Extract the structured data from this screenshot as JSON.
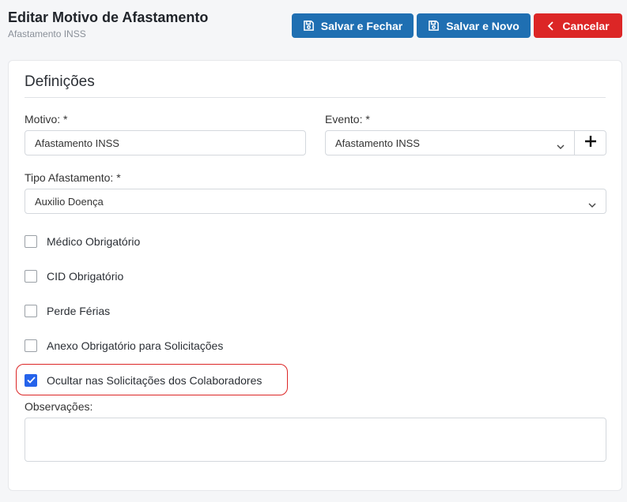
{
  "header": {
    "title": "Editar Motivo de Afastamento",
    "subtitle": "Afastamento INSS",
    "buttons": {
      "save_close": "Salvar e Fechar",
      "save_new": "Salvar e Novo",
      "cancel": "Cancelar"
    }
  },
  "section": {
    "title": "Definições"
  },
  "form": {
    "motivo": {
      "label": "Motivo: *",
      "value": "Afastamento INSS"
    },
    "evento": {
      "label": "Evento: *",
      "value": "Afastamento INSS"
    },
    "tipo": {
      "label": "Tipo Afastamento: *",
      "value": "Auxilio Doença"
    },
    "checkboxes": [
      {
        "label": "Médico Obrigatório",
        "checked": false
      },
      {
        "label": "CID Obrigatório",
        "checked": false
      },
      {
        "label": "Perde Férias",
        "checked": false
      },
      {
        "label": "Anexo Obrigatório para Solicitações",
        "checked": false
      },
      {
        "label": "Ocultar nas Solicitações dos Colaboradores",
        "checked": true
      }
    ],
    "observacoes": {
      "label": "Observações:",
      "value": ""
    }
  },
  "colors": {
    "primary": "#1f6fb2",
    "danger": "#dc2626",
    "checkbox": "#2563eb"
  }
}
